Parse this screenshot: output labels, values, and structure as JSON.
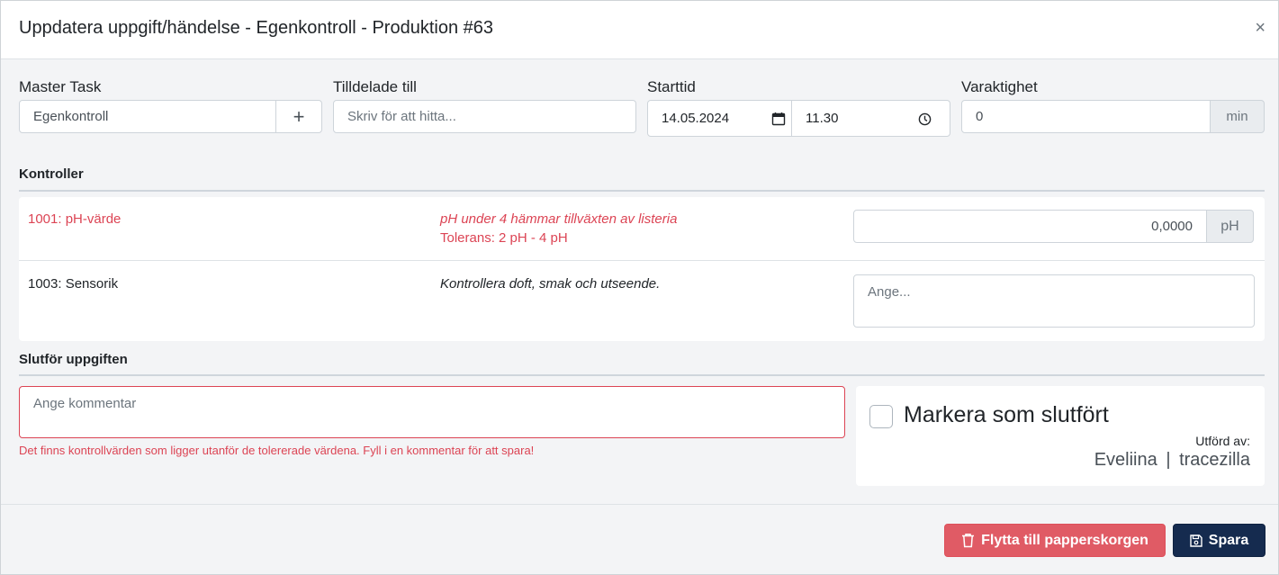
{
  "modal": {
    "title": "Uppdatera uppgift/händelse - Egenkontroll - Produktion #63",
    "close_glyph": "×"
  },
  "fields": {
    "master_task": {
      "label": "Master Task",
      "value": "Egenkontroll",
      "add_glyph": "+"
    },
    "assigned": {
      "label": "Tilldelade till",
      "placeholder": "Skriv för att hitta..."
    },
    "start": {
      "label": "Starttid",
      "date": "14.05.2024",
      "time": "11.30"
    },
    "duration": {
      "label": "Varaktighet",
      "value": "0",
      "unit": "min"
    }
  },
  "controls": {
    "title": "Kontroller",
    "items": [
      {
        "name": "1001: pH-värde",
        "description": "pH under 4 hämmar tillväxten av listeria",
        "tolerance": "Tolerans: 2 pH - 4 pH",
        "value": "0,0000",
        "unit": "pH"
      },
      {
        "name": "1003: Sensorik",
        "description": "Kontrollera doft, smak och utseende.",
        "placeholder": "Ange..."
      }
    ]
  },
  "complete": {
    "title": "Slutför uppgiften",
    "comment_placeholder": "Ange kommentar",
    "error": "Det finns kontrollvärden som ligger utanför de tolererade värdena. Fyll i en kommentar för att spara!",
    "mark_label": "Markera som slutfört",
    "performed_by_label": "Utförd av:",
    "performed_by_user": "Eveliina",
    "separator": "|",
    "performed_by_org": "tracezilla"
  },
  "footer": {
    "trash_label": "Flytta till papperskorgen",
    "save_label": "Spara"
  },
  "colors": {
    "danger": "#dc4454",
    "primary": "#152b4f"
  },
  "icons": {
    "trash": "trash-icon",
    "save": "floppy-disk-icon",
    "calendar": "calendar-icon",
    "clock": "clock-icon"
  }
}
